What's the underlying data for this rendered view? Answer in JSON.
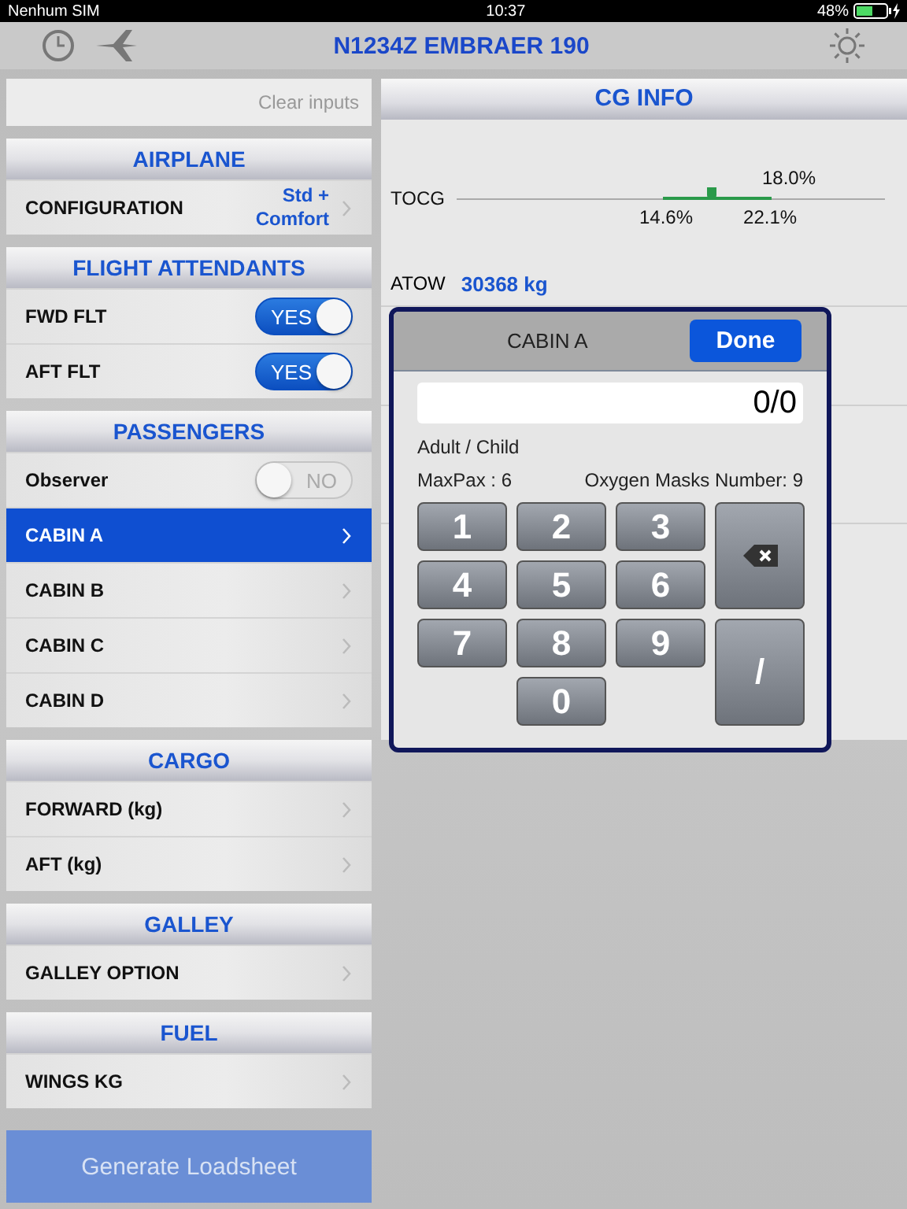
{
  "status_bar": {
    "carrier": "Nenhum SIM",
    "time": "10:37",
    "battery": "48%"
  },
  "nav": {
    "title": "N1234Z EMBRAER 190"
  },
  "sidebar": {
    "clear": "Clear inputs",
    "sections": [
      {
        "title": "AIRPLANE",
        "rows": [
          {
            "kind": "value",
            "label": "CONFIGURATION",
            "value": "Std +\nComfort",
            "selected": false
          }
        ]
      },
      {
        "title": "FLIGHT ATTENDANTS",
        "rows": [
          {
            "kind": "toggle",
            "label": "FWD FLT",
            "on": true,
            "state": "YES"
          },
          {
            "kind": "toggle",
            "label": "AFT FLT",
            "on": true,
            "state": "YES"
          }
        ]
      },
      {
        "title": "PASSENGERS",
        "rows": [
          {
            "kind": "toggle",
            "label": "Observer",
            "on": false,
            "state": "NO"
          },
          {
            "kind": "link",
            "label": "CABIN A",
            "selected": true
          },
          {
            "kind": "link",
            "label": "CABIN B",
            "selected": false
          },
          {
            "kind": "link",
            "label": "CABIN C",
            "selected": false
          },
          {
            "kind": "link",
            "label": "CABIN D",
            "selected": false
          }
        ]
      },
      {
        "title": "CARGO",
        "rows": [
          {
            "kind": "link",
            "label": "FORWARD (kg)",
            "selected": false
          },
          {
            "kind": "link",
            "label": "AFT (kg)",
            "selected": false
          }
        ]
      },
      {
        "title": "GALLEY",
        "rows": [
          {
            "kind": "link",
            "label": "GALLEY OPTION",
            "selected": false
          }
        ]
      },
      {
        "title": "FUEL",
        "rows": [
          {
            "kind": "link",
            "label": "WINGS KG",
            "selected": false
          }
        ]
      }
    ],
    "generate": "Generate Loadsheet"
  },
  "cg_info": {
    "title": "CG INFO",
    "tocg": {
      "label": "TOCG",
      "value": "18.0%",
      "min": "14.6%",
      "max": "22.1%",
      "level": 0.45
    },
    "atow": {
      "label": "ATOW",
      "value": "30368 kg"
    }
  },
  "popup": {
    "title": "CABIN A",
    "done": "Done",
    "value": "0/0",
    "hint": "Adult / Child",
    "max_pax": "MaxPax : 6",
    "oxygen": "Oxygen Masks Number: 9",
    "keys": [
      {
        "kind": "digit",
        "label": "1"
      },
      {
        "kind": "digit",
        "label": "2"
      },
      {
        "kind": "digit",
        "label": "3"
      },
      {
        "kind": "backspace"
      },
      {
        "kind": "digit",
        "label": "4"
      },
      {
        "kind": "digit",
        "label": "5"
      },
      {
        "kind": "digit",
        "label": "6"
      },
      {
        "kind": "digit",
        "label": "7"
      },
      {
        "kind": "digit",
        "label": "8"
      },
      {
        "kind": "digit",
        "label": "9"
      },
      {
        "kind": "slash",
        "label": "/"
      },
      {
        "kind": "digit",
        "label": "0"
      }
    ]
  }
}
